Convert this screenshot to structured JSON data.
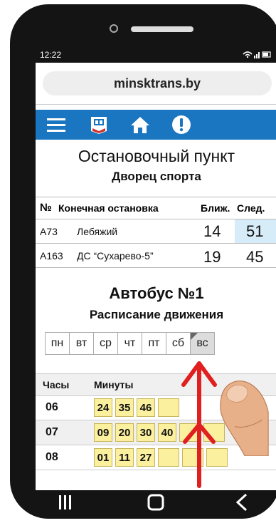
{
  "status": {
    "time": "12:22",
    "icons": "wifi-signal-battery"
  },
  "browser": {
    "url": "minsktrans.by"
  },
  "nav": {
    "icons": [
      "menu-icon",
      "bus-icon",
      "home-icon",
      "alert-icon"
    ],
    "accent": "#1a76c0"
  },
  "stop": {
    "heading": "Остановочный пункт",
    "name": "Дворец спорта"
  },
  "routes_table": {
    "headers": {
      "no": "№",
      "dest": "Конечная остановка",
      "near": "Ближ.",
      "next": "След."
    },
    "rows": [
      {
        "route": "A73",
        "dest": "Лебяжий",
        "near": "14",
        "next": "51",
        "highlight": true
      },
      {
        "route": "A163",
        "dest": "ДС “Сухарево-5”",
        "near": "19",
        "next": "45",
        "highlight": false
      }
    ]
  },
  "bus": {
    "title": "Автобус №1",
    "subtitle": "Расписание движения"
  },
  "days": [
    {
      "label": "пн",
      "selected": false
    },
    {
      "label": "вт",
      "selected": false
    },
    {
      "label": "ср",
      "selected": false
    },
    {
      "label": "чт",
      "selected": false
    },
    {
      "label": "пт",
      "selected": false
    },
    {
      "label": "сб",
      "selected": false
    },
    {
      "label": "вс",
      "selected": true
    }
  ],
  "schedule": {
    "headers": {
      "hours": "Часы",
      "minutes": "Минуты"
    },
    "rows": [
      {
        "hour": "06",
        "minutes": [
          "24",
          "35",
          "46",
          ""
        ]
      },
      {
        "hour": "07",
        "minutes": [
          "09",
          "20",
          "30",
          "40",
          "",
          ""
        ]
      },
      {
        "hour": "08",
        "minutes": [
          "01",
          "11",
          "27",
          "",
          "",
          ""
        ]
      }
    ]
  },
  "bottom_nav": {
    "icons": [
      "recent-apps-icon",
      "home-button-icon",
      "back-icon"
    ]
  }
}
